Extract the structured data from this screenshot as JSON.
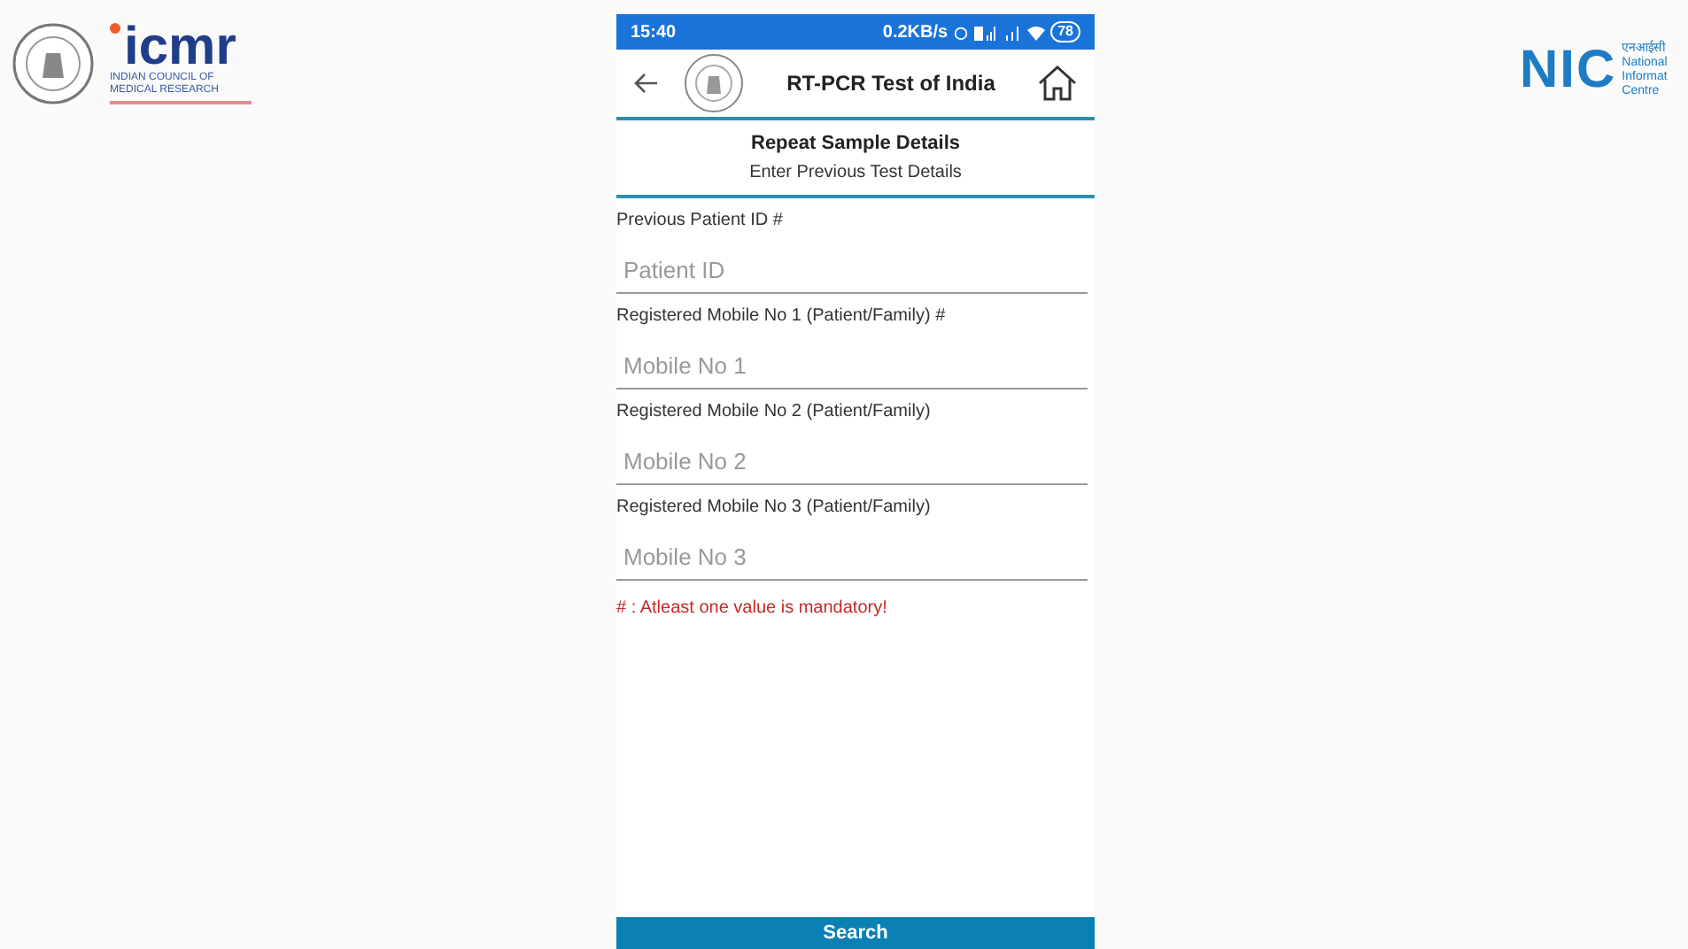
{
  "left_logo": {
    "wordmark": "icmr",
    "lines": [
      "INDIAN COUNCIL OF",
      "MEDICAL RESEARCH"
    ]
  },
  "right_logo": {
    "wordmark": "NIC",
    "lines": [
      "एनआईसी",
      "National",
      "Informat",
      "Centre"
    ]
  },
  "status_bar": {
    "time": "15:40",
    "speed": "0.2KB/s",
    "battery": "78"
  },
  "app_bar": {
    "title": "RT-PCR Test of India"
  },
  "header": {
    "title": "Repeat Sample Details",
    "subtitle": "Enter Previous Test Details"
  },
  "fields": [
    {
      "label": "Previous Patient ID #",
      "placeholder": "Patient ID"
    },
    {
      "label": "Registered Mobile No 1 (Patient/Family) #",
      "placeholder": "Mobile No 1"
    },
    {
      "label": "Registered Mobile No 2 (Patient/Family)",
      "placeholder": "Mobile No 2"
    },
    {
      "label": "Registered Mobile No 3 (Patient/Family)",
      "placeholder": "Mobile No 3"
    }
  ],
  "note": "# : Atleast one value is mandatory!",
  "button": "Search"
}
